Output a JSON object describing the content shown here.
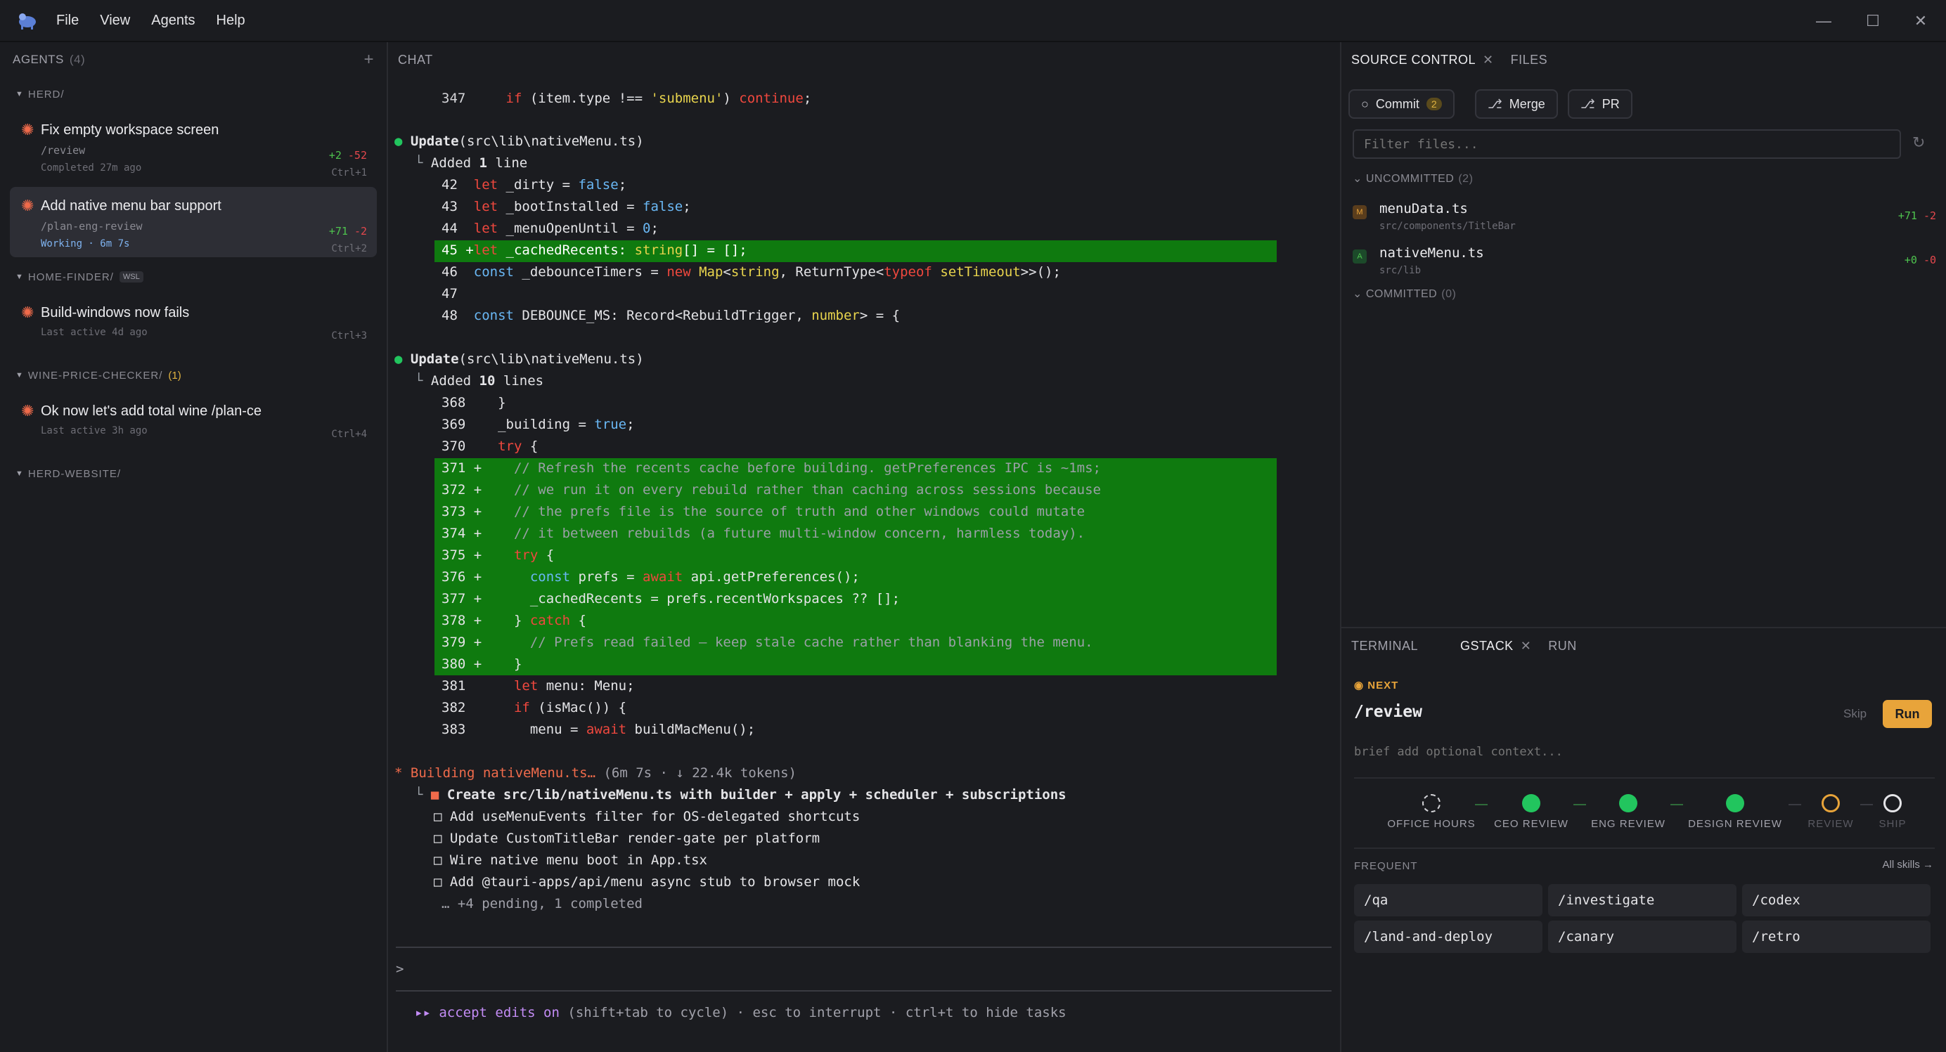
{
  "menu": [
    "File",
    "View",
    "Agents",
    "Help"
  ],
  "sidebar": {
    "header": "AGENTS",
    "count": "(4)",
    "add": "+",
    "groups": [
      {
        "name": "HERD/",
        "badge": "",
        "count": ""
      },
      {
        "name": "HOME-FINDER/",
        "badge": "WSL",
        "count": ""
      },
      {
        "name": "WINE-PRICE-CHECKER/",
        "badge": "",
        "count": "(1)"
      },
      {
        "name": "HERD-WEBSITE/",
        "badge": "",
        "count": ""
      }
    ],
    "agents": [
      {
        "title": "Fix empty workspace screen",
        "sub": "/review",
        "status": "Completed 27m ago",
        "plus": "+2",
        "minus": "-52",
        "shortcut": "Ctrl+1"
      },
      {
        "title": "Add native menu bar support",
        "sub": "/plan-eng-review",
        "status": "Working · 6m 7s",
        "plus": "+71",
        "minus": "-2",
        "shortcut": "Ctrl+2"
      },
      {
        "title": "Build-windows now fails",
        "sub": "",
        "status": "Last active 4d ago",
        "plus": "",
        "minus": "",
        "shortcut": "Ctrl+3"
      },
      {
        "title": "Ok now let's add total wine /plan-ce",
        "sub": "",
        "status": "Last active 3h ago",
        "plus": "",
        "minus": "",
        "shortcut": "Ctrl+4"
      }
    ]
  },
  "chat": {
    "header": "CHAT",
    "update1": {
      "verb": "Update",
      "path": "(src\\lib\\nativeMenu.ts)",
      "added_prefix": "Added ",
      "added_n": "1",
      "added_suffix": " line"
    },
    "update2": {
      "verb": "Update",
      "path": "(src\\lib\\nativeMenu.ts)",
      "added_prefix": "Added ",
      "added_n": "10",
      "added_suffix": " lines"
    },
    "building": {
      "label": "Building nativeMenu.ts…",
      "meta": " (6m 7s · ↓ 22.4k tokens)"
    },
    "tasks": [
      "Create src/lib/nativeMenu.ts with builder + apply + scheduler + subscriptions",
      "Add useMenuEvents filter for OS-delegated shortcuts",
      "Update CustomTitleBar render-gate per platform",
      "Wire native menu boot in App.tsx",
      "Add @tauri-apps/api/menu async stub to browser mock"
    ],
    "pending": "… +4 pending, 1 completed",
    "prompt": ">",
    "footer": {
      "mode": "accept edits on",
      "rest": " (shift+tab to cycle) · esc to interrupt · ctrl+t to hide tasks"
    }
  },
  "source_control": {
    "tabs": [
      "SOURCE CONTROL",
      "FILES"
    ],
    "buttons": {
      "commit": "Commit",
      "commit_count": "2",
      "merge": "Merge",
      "pr": "PR"
    },
    "filter_placeholder": "Filter files...",
    "uncommitted_label": "UNCOMMITTED",
    "uncommitted_count": "(2)",
    "committed_label": "COMMITTED",
    "committed_count": "(0)",
    "files": [
      {
        "badge": "M",
        "name": "menuData.ts",
        "path": "src/components/TitleBar",
        "plus": "+71",
        "minus": "-2"
      },
      {
        "badge": "A",
        "name": "nativeMenu.ts",
        "path": "src/lib",
        "plus": "+0",
        "minus": "-0"
      }
    ]
  },
  "gstack": {
    "tabs": [
      "TERMINAL",
      "GSTACK",
      "RUN"
    ],
    "next_label": "NEXT",
    "next_title": "/review",
    "skip": "Skip",
    "run": "Run",
    "context_placeholder": "brief add optional context...",
    "steps": [
      {
        "label": "OFFICE HOURS",
        "state": "pending-dashed"
      },
      {
        "label": "CEO REVIEW",
        "state": "done"
      },
      {
        "label": "ENG REVIEW",
        "state": "done"
      },
      {
        "label": "DESIGN REVIEW",
        "state": "done"
      },
      {
        "label": "REVIEW",
        "state": "current"
      },
      {
        "label": "SHIP",
        "state": "todo"
      }
    ],
    "frequent_label": "FREQUENT",
    "all_skills": "All skills →",
    "skills": [
      "/qa",
      "/investigate",
      "/codex",
      "/land-and-deploy",
      "/canary",
      "/retro"
    ]
  },
  "colors": {
    "accent": "#e8a43a",
    "added_bg": "#0f7a0f",
    "done": "#22c55e",
    "keyword": "#f0483e",
    "type": "#e8d44d",
    "bool": "#6ab8f5"
  }
}
